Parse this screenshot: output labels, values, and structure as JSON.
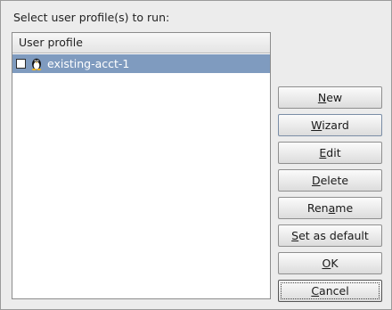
{
  "prompt": "Select user profile(s) to run:",
  "list": {
    "header": "User profile",
    "items": [
      {
        "label": "existing-acct-1",
        "checked": false,
        "selected": true,
        "icon": "tux-icon"
      }
    ]
  },
  "buttons": [
    {
      "pre": "",
      "acc": "N",
      "post": "ew"
    },
    {
      "pre": "",
      "acc": "W",
      "post": "izard"
    },
    {
      "pre": "",
      "acc": "E",
      "post": "dit"
    },
    {
      "pre": "",
      "acc": "D",
      "post": "elete"
    },
    {
      "pre": "Ren",
      "acc": "a",
      "post": "me"
    },
    {
      "pre": "",
      "acc": "S",
      "post": "et as default"
    },
    {
      "pre": "",
      "acc": "O",
      "post": "K"
    },
    {
      "pre": "",
      "acc": "C",
      "post": "ancel"
    }
  ],
  "colors": {
    "selection": "#7f9bbf",
    "background": "#ececec"
  }
}
